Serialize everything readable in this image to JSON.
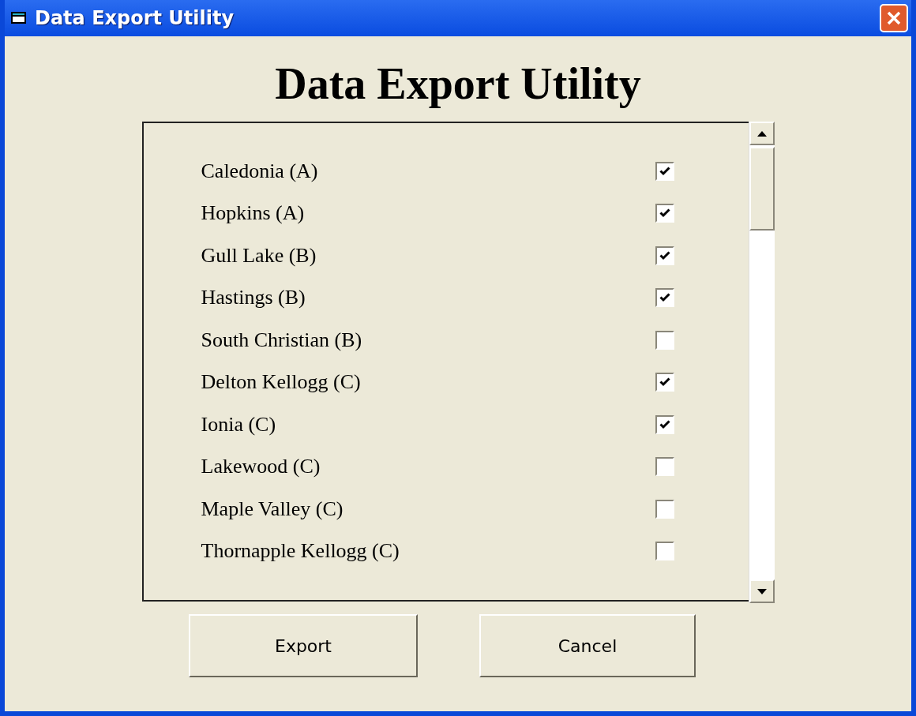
{
  "window": {
    "title": "Data Export Utility"
  },
  "heading": "Data Export Utility",
  "items": [
    {
      "label": "Caledonia (A)",
      "checked": true
    },
    {
      "label": "Hopkins (A)",
      "checked": true
    },
    {
      "label": "Gull Lake (B)",
      "checked": true
    },
    {
      "label": "Hastings (B)",
      "checked": true
    },
    {
      "label": "South Christian (B)",
      "checked": false
    },
    {
      "label": "Delton Kellogg (C)",
      "checked": true
    },
    {
      "label": "Ionia (C)",
      "checked": true
    },
    {
      "label": "Lakewood (C)",
      "checked": false
    },
    {
      "label": "Maple Valley (C)",
      "checked": false
    },
    {
      "label": "Thornapple Kellogg (C)",
      "checked": false
    }
  ],
  "buttons": [
    "Export",
    "Cancel"
  ]
}
